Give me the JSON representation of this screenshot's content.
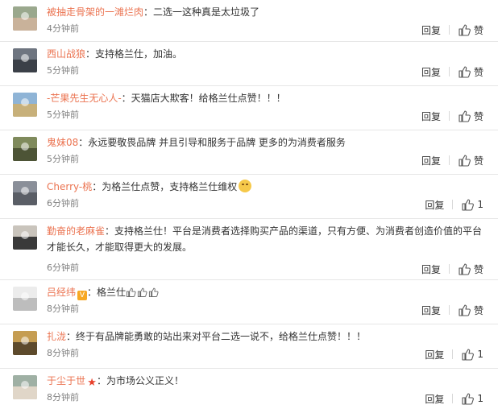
{
  "comments": [
    {
      "user": "被抽走骨架的一滩烂肉",
      "text": "：二选一这种真是太垃圾了",
      "time": "4分钟前",
      "reply": "回复",
      "likes": "赞",
      "avatar_color": "#9aa88d",
      "avatar_shade": "#c9b29a"
    },
    {
      "user": "西山战狼",
      "text": "：支持格兰仕，加油。",
      "time": "5分钟前",
      "reply": "回复",
      "likes": "赞",
      "avatar_color": "#6e7580",
      "avatar_shade": "#3b4048"
    },
    {
      "user": "-芒果先生无心人-",
      "text": "：天猫店大欺客！给格兰仕点赞！！！",
      "time": "5分钟前",
      "reply": "回复",
      "likes": "赞",
      "avatar_color": "#8fb4d6",
      "avatar_shade": "#c7b07a"
    },
    {
      "user": "鬼妹08",
      "text": "：永远要敬畏品牌 并且引导和服务于品牌 更多的为消费者服务",
      "time": "5分钟前",
      "reply": "回复",
      "likes": "赞",
      "avatar_color": "#7f8a5c",
      "avatar_shade": "#4d5436"
    },
    {
      "user": "Cherry-桃",
      "text": "：为格兰仕点赞，支持格兰仕维权",
      "time": "6分钟前",
      "reply": "回复",
      "likes": "1",
      "avatar_color": "#8a8f99",
      "avatar_shade": "#5a5e66",
      "emoji": "smile-emoji"
    },
    {
      "user": "勤奋的老麻雀",
      "text": "：支持格兰仕！平台是消费者选择购买产品的渠道，只有方便、为消费者创造价值的平台才能长久，才能取得更大的发展。",
      "time": "6分钟前",
      "reply": "回复",
      "likes": "赞",
      "avatar_color": "#c9c4bc",
      "avatar_shade": "#3a3a3a"
    },
    {
      "user": "吕经纬",
      "text": "：格兰仕",
      "time": "8分钟前",
      "reply": "回复",
      "likes": "赞",
      "avatar_color": "#ececec",
      "avatar_shade": "#bdbdbd",
      "badge": "V",
      "badge_color": "#f7a823",
      "thumbs": true
    },
    {
      "user": "扎泷",
      "text": "：终于有品牌能勇敢的站出来对平台二选一说不，给格兰仕点赞！！！",
      "time": "8分钟前",
      "reply": "回复",
      "likes": "1",
      "avatar_color": "#c59d52",
      "avatar_shade": "#5d4a2c"
    },
    {
      "user": "于尘于世",
      "text": "：为市场公义正义！",
      "time": "8分钟前",
      "reply": "回复",
      "likes": "1",
      "avatar_color": "#9fb0a4",
      "avatar_shade": "#e0d6c8",
      "badge": "★",
      "badge_color": "#e8412c"
    }
  ]
}
